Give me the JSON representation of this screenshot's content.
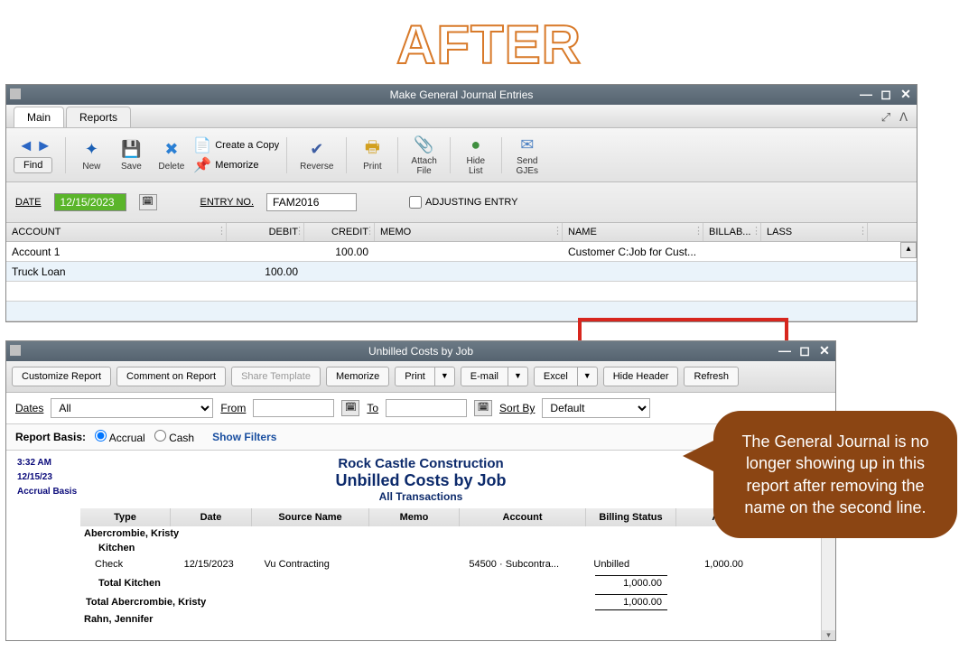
{
  "after_label": "AFTER",
  "journal_window": {
    "title": "Make General Journal Entries",
    "tabs": {
      "main": "Main",
      "reports": "Reports"
    },
    "nav": {
      "find": "Find"
    },
    "toolbar": {
      "new": "New",
      "save": "Save",
      "delete": "Delete",
      "create_copy": "Create a Copy",
      "memorize": "Memorize",
      "reverse": "Reverse",
      "print": "Print",
      "attach_file_l1": "Attach",
      "attach_file_l2": "File",
      "hide_list_l1": "Hide",
      "hide_list_l2": "List",
      "send_gjes_l1": "Send",
      "send_gjes_l2": "GJEs"
    },
    "form": {
      "date_label": "DATE",
      "date_value": "12/15/2023",
      "entry_label": "ENTRY NO.",
      "entry_value": "FAM2016",
      "adjusting_label": "ADJUSTING ENTRY"
    },
    "grid_headers": {
      "account": "ACCOUNT",
      "debit": "DEBIT",
      "credit": "CREDIT",
      "memo": "MEMO",
      "name": "NAME",
      "billab": "BILLAB...",
      "class": "LASS"
    },
    "rows": [
      {
        "account": "Account 1",
        "debit": "",
        "credit": "100.00",
        "memo": "",
        "name": "Customer C:Job for Cust...",
        "bill": "",
        "class": ""
      },
      {
        "account": "Truck Loan",
        "debit": "100.00",
        "credit": "",
        "memo": "",
        "name": "",
        "bill": "",
        "class": ""
      },
      {
        "account": "",
        "debit": "",
        "credit": "",
        "memo": "",
        "name": "",
        "bill": "",
        "class": ""
      },
      {
        "account": "",
        "debit": "",
        "credit": "",
        "memo": "",
        "name": "",
        "bill": "",
        "class": ""
      }
    ]
  },
  "report_window": {
    "title": "Unbilled Costs by Job",
    "toolbar": {
      "customize": "Customize Report",
      "comment": "Comment on Report",
      "share": "Share Template",
      "memorize": "Memorize",
      "print": "Print",
      "email": "E-mail",
      "excel": "Excel",
      "hide_header": "Hide Header",
      "refresh": "Refresh"
    },
    "filter": {
      "dates_label": "Dates",
      "dates_value": "All",
      "from_label": "From",
      "to_label": "To",
      "sortby_label": "Sort By",
      "sortby_value": "Default"
    },
    "basis": {
      "label": "Report Basis:",
      "accrual": "Accrual",
      "cash": "Cash",
      "show_filters": "Show Filters"
    },
    "meta": {
      "time": "3:32 AM",
      "date": "12/15/23",
      "basis": "Accrual Basis"
    },
    "heading": {
      "company": "Rock Castle Construction",
      "report": "Unbilled Costs by Job",
      "sub": "All Transactions"
    },
    "columns": {
      "type": "Type",
      "date": "Date",
      "sname": "Source Name",
      "memo": "Memo",
      "acct": "Account",
      "bill": "Billing Status",
      "amt": "Amo..."
    },
    "data": {
      "group1": "Abercrombie, Kristy",
      "sub1": "Kitchen",
      "row1": {
        "type": "Check",
        "date": "12/15/2023",
        "sname": "Vu Contracting",
        "memo": "",
        "acct": "54500 · Subcontra...",
        "bill": "Unbilled",
        "amt": "1,000.00"
      },
      "total_sub1": "Total Kitchen",
      "total_sub1_amt": "1,000.00",
      "total_g1": "Total Abercrombie, Kristy",
      "total_g1_amt": "1,000.00",
      "group2": "Rahn, Jennifer"
    }
  },
  "callout_text": "The General Journal is no longer showing up in this report after removing the name on the second line."
}
